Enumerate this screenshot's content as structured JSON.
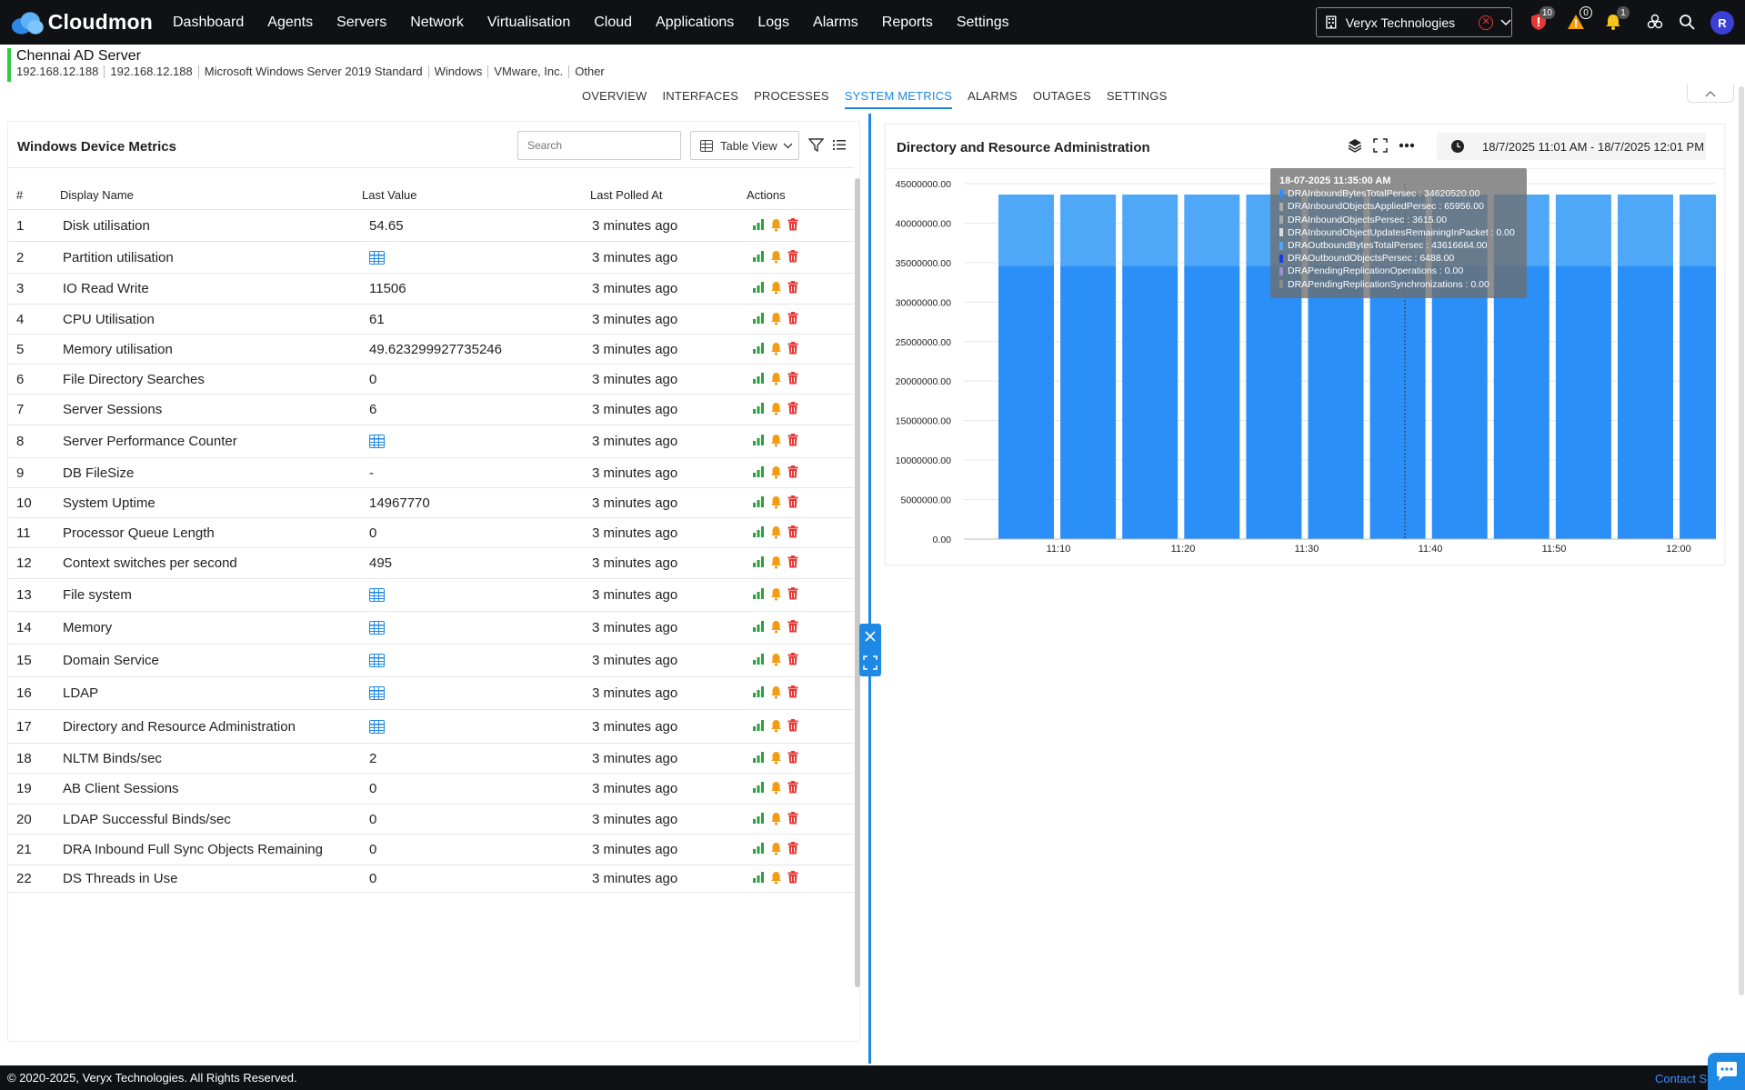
{
  "brand": {
    "name": "Cloudmon"
  },
  "nav": [
    "Dashboard",
    "Agents",
    "Servers",
    "Network",
    "Virtualisation",
    "Cloud",
    "Applications",
    "Logs",
    "Alarms",
    "Reports",
    "Settings"
  ],
  "org": {
    "name": "Veryx Technologies"
  },
  "badges": {
    "shield": "10",
    "warning": "0",
    "bell": "1"
  },
  "user": {
    "initial": "R"
  },
  "device": {
    "name": "Chennai AD Server",
    "meta": [
      "192.168.12.188",
      "192.168.12.188",
      "Microsoft Windows Server 2019 Standard",
      "Windows",
      "VMware, Inc.",
      "Other"
    ]
  },
  "tabs": [
    "OVERVIEW",
    "INTERFACES",
    "PROCESSES",
    "SYSTEM METRICS",
    "ALARMS",
    "OUTAGES",
    "SETTINGS"
  ],
  "active_tab": "SYSTEM METRICS",
  "left": {
    "title": "Windows Device Metrics",
    "search_placeholder": "Search",
    "view_label": "Table View",
    "columns": [
      "#",
      "Display Name",
      "Last Value",
      "Last Polled At",
      "Actions"
    ],
    "rows": [
      {
        "idx": "1",
        "name": "Disk utilisation",
        "value": "54.65",
        "polled": "3 minutes ago",
        "table": false
      },
      {
        "idx": "2",
        "name": "Partition utilisation",
        "value": "",
        "polled": "3 minutes ago",
        "table": true
      },
      {
        "idx": "3",
        "name": "IO Read Write",
        "value": "11506",
        "polled": "3 minutes ago",
        "table": false
      },
      {
        "idx": "4",
        "name": "CPU Utilisation",
        "value": "61",
        "polled": "3 minutes ago",
        "table": false
      },
      {
        "idx": "5",
        "name": "Memory utilisation",
        "value": "49.623299927735246",
        "polled": "3 minutes ago",
        "table": false
      },
      {
        "idx": "6",
        "name": "File Directory Searches",
        "value": "0",
        "polled": "3 minutes ago",
        "table": false
      },
      {
        "idx": "7",
        "name": "Server Sessions",
        "value": "6",
        "polled": "3 minutes ago",
        "table": false
      },
      {
        "idx": "8",
        "name": "Server Performance Counter",
        "value": "",
        "polled": "3 minutes ago",
        "table": true
      },
      {
        "idx": "9",
        "name": "DB FileSize",
        "value": "-",
        "polled": "3 minutes ago",
        "table": false
      },
      {
        "idx": "10",
        "name": "System Uptime",
        "value": "14967770",
        "polled": "3 minutes ago",
        "table": false
      },
      {
        "idx": "11",
        "name": "Processor Queue Length",
        "value": "0",
        "polled": "3 minutes ago",
        "table": false
      },
      {
        "idx": "12",
        "name": "Context switches per second",
        "value": "495",
        "polled": "3 minutes ago",
        "table": false
      },
      {
        "idx": "13",
        "name": "File system",
        "value": "",
        "polled": "3 minutes ago",
        "table": true
      },
      {
        "idx": "14",
        "name": "Memory",
        "value": "",
        "polled": "3 minutes ago",
        "table": true
      },
      {
        "idx": "15",
        "name": "Domain Service",
        "value": "",
        "polled": "3 minutes ago",
        "table": true
      },
      {
        "idx": "16",
        "name": "LDAP",
        "value": "",
        "polled": "3 minutes ago",
        "table": true
      },
      {
        "idx": "17",
        "name": "Directory and Resource Administration",
        "value": "",
        "polled": "3 minutes ago",
        "table": true
      },
      {
        "idx": "18",
        "name": "NLTM Binds/sec",
        "value": "2",
        "polled": "3 minutes ago",
        "table": false
      },
      {
        "idx": "19",
        "name": "AB Client Sessions",
        "value": "0",
        "polled": "3 minutes ago",
        "table": false
      },
      {
        "idx": "20",
        "name": "LDAP Successful Binds/sec",
        "value": "0",
        "polled": "3 minutes ago",
        "table": false
      },
      {
        "idx": "21",
        "name": "DRA Inbound Full Sync Objects Remaining",
        "value": "0",
        "polled": "3 minutes ago",
        "table": false
      },
      {
        "idx": "22",
        "name": "DS Threads in Use",
        "value": "0",
        "polled": "3 minutes ago",
        "table": false
      }
    ]
  },
  "right": {
    "title": "Directory and Resource Administration",
    "time_range": "18/7/2025 11:01 AM - 18/7/2025 12:01 PM"
  },
  "chart_data": {
    "type": "bar",
    "stacked": true,
    "ylim": [
      0,
      45000000
    ],
    "yticks": [
      "0.00",
      "5000000.00",
      "10000000.00",
      "15000000.00",
      "20000000.00",
      "25000000.00",
      "30000000.00",
      "35000000.00",
      "40000000.00",
      "45000000.00"
    ],
    "xticks": [
      "11:10",
      "11:20",
      "11:30",
      "11:40",
      "11:50",
      "12:00"
    ],
    "bar_count": 12,
    "grid": true,
    "colors": {
      "lower": "#2a8ff7",
      "upper": "#4fa7f8"
    },
    "series": [
      {
        "name": "DRAInboundBytesTotalPersec",
        "values": [
          34620520,
          34620520,
          34620520,
          34620520,
          34620520,
          34620520,
          34620520,
          34620520,
          34620520,
          34620520,
          34620520,
          34620520
        ]
      },
      {
        "name": "DRAOutboundBytesTotalPersec",
        "values": [
          9000000,
          9000000,
          9000000,
          9000000,
          9000000,
          9000000,
          9000000,
          9000000,
          9000000,
          9000000,
          9000000,
          9000000
        ]
      }
    ],
    "tooltip": {
      "title": "18-07-2025 11:35:00 AM",
      "lines": [
        {
          "text": "DRAInboundBytesTotalPersec : 34620520.00",
          "color": "#2a8ff7"
        },
        {
          "text": "DRAInboundObjectsAppliedPersec : 65956.00",
          "color": "#aaaaaa"
        },
        {
          "text": "DRAInboundObjectsPersec : 3615.00",
          "color": "#aaaaaa"
        },
        {
          "text": "DRAInboundObjectUpdatesRemainingInPacket : 0.00",
          "color": "#dddddd"
        },
        {
          "text": "DRAOutboundBytesTotalPersec : 43616664.00",
          "color": "#4fa7f8"
        },
        {
          "text": "DRAOutboundObjectsPersec : 6488.00",
          "color": "#1a3fd6"
        },
        {
          "text": "DRAPendingReplicationOperations : 0.00",
          "color": "#9b8fd0"
        },
        {
          "text": "DRAPendingReplicationSynchronizations : 0.00",
          "color": "#8a8a8a"
        }
      ]
    }
  },
  "footer": {
    "copyright": "© 2020-2025, Veryx Technologies. All Rights Reserved.",
    "contact": "Contact Su"
  },
  "icons": {
    "bar_chart": "bar-chart-icon",
    "bell": "bell-icon",
    "delete": "delete-icon",
    "table": "table-icon"
  }
}
